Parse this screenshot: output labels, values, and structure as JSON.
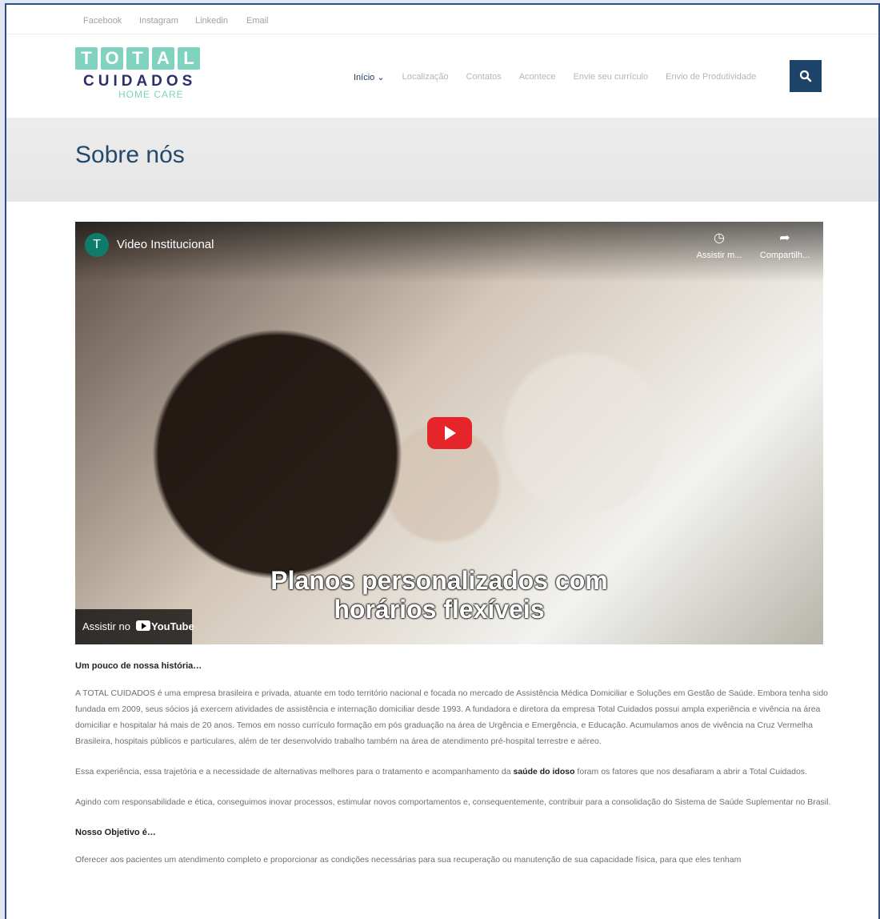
{
  "social": {
    "links": [
      "Facebook",
      "Instagram",
      "Linkedin",
      "Email"
    ]
  },
  "logo": {
    "letters": [
      "T",
      "O",
      "T",
      "A",
      "L"
    ],
    "line2": "CUIDADOS",
    "line3": "HOME CARE"
  },
  "nav": {
    "items": [
      {
        "label": "Início ⌄",
        "active": true
      },
      {
        "label": "Localização"
      },
      {
        "label": "Contatos"
      },
      {
        "label": "Acontece"
      },
      {
        "label": "Envie seu currículo"
      },
      {
        "label": "Envio de Produtividade"
      }
    ],
    "search_icon": "search-icon"
  },
  "hero": {
    "title": "Sobre nós"
  },
  "video": {
    "channel_initial": "T",
    "title": "Video Institucional",
    "watch_later_label": "Assistir m...",
    "share_label": "Compartilh...",
    "caption_line1": "Planos personalizados com",
    "caption_line2": "horários flexíveis",
    "youtube_prefix": "Assistir no",
    "youtube_brand": "YouTube"
  },
  "content": {
    "heading1": "Um pouco de nossa história…",
    "para1": "A TOTAL CUIDADOS é uma empresa brasileira e privada, atuante em todo território nacional e focada no mercado de Assistência Médica Domiciliar e Soluções em Gestão de Saúde. Embora tenha sido fundada em 2009, seus sócios já exercem atividades de assistência e internação domiciliar desde 1993. A fundadora e diretora da empresa Total Cuidados possui ampla experiência e vivência na área domiciliar e hospitalar há mais de 20 anos. Temos em nosso currículo formação em pós graduação na área de Urgência e Emergência, e Educação. Acumulamos anos de vivência na Cruz Vermelha Brasileira, hospitais públicos e particulares, além de ter desenvolvido trabalho também na área de atendimento pré-hospital terrestre e aéreo.",
    "para2_before": "Essa experiência, essa trajetória e a necessidade de alternativas melhores para o tratamento e acompanhamento da ",
    "para2_bold": "saúde do idoso",
    "para2_after": " foram os fatores que nos desafiaram a abrir a Total Cuidados.",
    "para3": "Agindo com responsabilidade e ética, conseguimos inovar processos, estimular novos comportamentos e, consequentemente, contribuir para a consolidação do Sistema de Saúde Suplementar no Brasil.",
    "heading2": "Nosso Objetivo é…",
    "para4": "Oferecer aos pacientes um atendimento completo e proporcionar as condições necessárias para sua recuperação ou manutenção de sua capacidade física, para que eles tenham"
  }
}
